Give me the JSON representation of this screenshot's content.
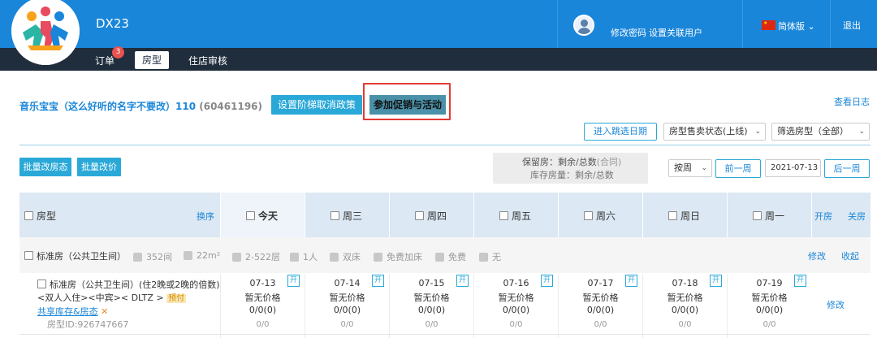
{
  "header": {
    "app_title": "DX23",
    "change_password": "修改密码",
    "linked_users": "设置关联用户",
    "language": "简体版",
    "logout": "退出",
    "colors": {
      "topbar": "#1a86d9",
      "navbar": "#1f2d3d",
      "accent": "#2aa8d8",
      "highlight": "#e53935"
    }
  },
  "nav": {
    "orders": "订单",
    "orders_badge": "3",
    "room_types": "房型",
    "checkin_review": "住店审核"
  },
  "toolbar": {
    "hotel_name": "音乐宝宝（这么好听的名字不要改）110",
    "hotel_id": "(60461196)",
    "cancel_policy_btn": "设置阶梯取消政策",
    "promo_btn": "参加促销与活动",
    "view_log": "查看日志",
    "jump_date_btn": "进入跳选日期",
    "sale_status_select": "房型售卖状态(上线)",
    "filter_room_select": "筛选房型（全部）",
    "bulk_status_btn": "批量改房态",
    "bulk_price_btn": "批量改价",
    "legend_line1": "保留房：剩余/总数",
    "legend_line1_gray": "(合同)",
    "legend_line2": "库存房量：剩余/总数",
    "period_select": "按周",
    "prev_week_btn": "前一周",
    "date_value": "2021-07-13",
    "next_week_btn": "后一周"
  },
  "grid": {
    "room_type_header": "房型",
    "swap_link": "换序",
    "days": [
      "今天",
      "周三",
      "周四",
      "周五",
      "周六",
      "周日",
      "周一"
    ],
    "open_all": "开房",
    "close_all": "关房"
  },
  "room_group": {
    "name": "标准房（公共卫生间）",
    "rooms_count": "352间",
    "area": "22m²",
    "floors": "2-522层",
    "occupancy": "1人",
    "bed": "双床",
    "extra_bed": "免费加床",
    "breakfast": "免费",
    "wifi": "无",
    "edit_link": "修改",
    "collapse_link": "收起"
  },
  "room_row": {
    "line1": "标准房（公共卫生间）(住2晚或2晚的倍数)",
    "line2": "<双人入住><中宾>< DLTZ >",
    "prepay_tag": "预付",
    "share_tag": "共享库存&房态",
    "room_id": "房型ID:926747667",
    "edit_link": "修改",
    "cells": [
      {
        "date": "07-13",
        "open": "开",
        "price": "暂无价格",
        "inventory": "0/0(0)",
        "sold": "0/0"
      },
      {
        "date": "07-14",
        "open": "开",
        "price": "暂无价格",
        "inventory": "0/0(0)",
        "sold": "0/0"
      },
      {
        "date": "07-15",
        "open": "开",
        "price": "暂无价格",
        "inventory": "0/0(0)",
        "sold": "0/0"
      },
      {
        "date": "07-16",
        "open": "开",
        "price": "暂无价格",
        "inventory": "0/0(0)",
        "sold": "0/0"
      },
      {
        "date": "07-17",
        "open": "开",
        "price": "暂无价格",
        "inventory": "0/0(0)",
        "sold": "0/0"
      },
      {
        "date": "07-18",
        "open": "开",
        "price": "暂无价格",
        "inventory": "0/0(0)",
        "sold": "0/0"
      },
      {
        "date": "07-19",
        "open": "开",
        "price": "暂无价格",
        "inventory": "0/0(0)",
        "sold": "0/0"
      }
    ]
  }
}
